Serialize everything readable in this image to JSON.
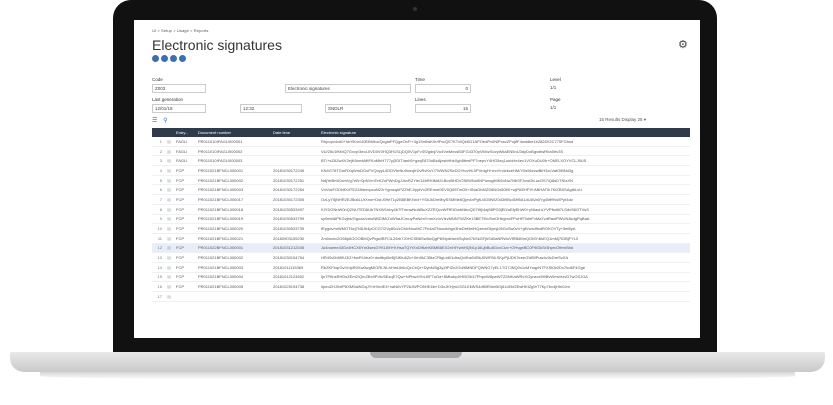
{
  "breadcrumb": "UI > Setup > Usage > Reports",
  "page": {
    "title": "Electronic signatures"
  },
  "form": {
    "code_label": "Code",
    "code_value": "Z003",
    "description_value": "Electronic signatures",
    "time_label": "Time",
    "time_value": "0",
    "level_label": "Level",
    "level_value": "1/1",
    "lastgen_label": "Last generation",
    "lastgen_date": "12/01/18",
    "lastgen_time": "12:32",
    "lastgen_user": "SNDLR",
    "lines_label": "Lines",
    "lines_value": "15",
    "page_label": "Page",
    "page_value": "1/1"
  },
  "results": {
    "text": "15 Results  Display  25  ▾"
  },
  "table": {
    "columns": [
      "",
      "",
      "Entry...",
      "Document number",
      "Date time",
      "Electronic signature"
    ],
    "rows": [
      {
        "n": "1",
        "entry": "FAGLI",
        "doc": "PR011010IFAGLI000001",
        "dt": "",
        "sig": "Rhpopv4cd0+hkYiKcnU0EBh9ocQcgiaPFQgeOcF/+3g1Sn6wK0r/tFvcQE7KTdIQkKD1APOedPv0NlPcsvZPoj8F4wddke1b2828X2C770FGhsd"
      },
      {
        "n": "2",
        "entry": "FAGLI",
        "doc": "PR011010IFAGLI000002",
        "dt": "",
        "sig": "VU/25c1fKfdQ7Gxvy/3eoL0VD0V0HQ3H1SLjDQ0V1pFv3S/gdnj/Vu4VwMxvsB3FG4370pVMxzSovyWkaEN5nU3dyDoBgxdtwRha5rtv3S"
      },
      {
        "n": "3",
        "entry": "FAGLI",
        "doc": "PR011010IFAGLI000003",
        "dt": "",
        "sig": "BT/+sZ6Zw4V2ejK6mvkMtFKoMbH777yj3OIT/anb5+gzqE870uBzAjxsbHhkXgh5tbwPF7nepvY4HG5zq1uuhHe4ev1VOXuDU0h+ONELXOYVCLJ9U5"
      },
      {
        "n": "4",
        "entry": "FCP",
        "doc": "PR011021BFNCL000001",
        "dt": "20181030172245",
        "sig": "KN4G78TGmRXqWmDGoFVQnyyL0DDVfrrNu9nnxjfrDvRvKsY/7WWN2SeDGYtovHL0PVrdgH+mnYn4vkzeHM/Y0s96zcwBIH3xLVatOiBNd3g"
      },
      {
        "n": "5",
        "entry": "FCP",
        "doc": "PR011021BFNCL000002",
        "dt": "20181030172251",
        "sig": "NdjYeBrtX0xmVg7eB+0pNVmTeKZuPWnDgJJsxRZYle/14bRHIMd2LBcxBHDV250WNu9NPunsgiMK6nNu7NbSFJcwGtLucOS7iQ8sDTNIzXN"
      },
      {
        "n": "6",
        "entry": "FCP",
        "doc": "PR011021BFNCL000003",
        "dt": "20181030172254",
        "sig": "VnVckFGDNfXdTE228rbecpcuN22rYgmzqhPZZhEJ/pytVv2REmm0EV0Q65TmD5+0NaGbMZS6NGx60lfX+wjPAEHF9+ABHATIh7KfZBSSAgi6LvU"
      },
      {
        "n": "7",
        "entry": "FCP",
        "doc": "PR011021BFNCL000017",
        "dt": "20181030172305",
        "sig": "OzLyY5jNHR2EJBu6LUrXnw+DdrJ09eTLy2B8EBKNn4+YSkJkDm9bySSMMe6Qjm4nPgfU4G0lWZ0d3i9Bc4Mf5A1dUAVa0Yg4MffHaXPpt4dz"
      },
      {
        "n": "8",
        "entry": "FCP",
        "doc": "PR011021BFNCL000018",
        "dt": "20181030533497",
        "sig": "KIYDGNnW0nQ2NUTED6Ub7NXW1hby4bTfTmnwNuNBuXZZRQvvWFfEtGwbNbuQD7t9j/4aj98PG0jE0/uEfyEhW0+yNIauhLYVPfsditi7LSdvS6OTVsS"
      },
      {
        "n": "9",
        "entry": "FCP",
        "doc": "PR011021BFNCL000019",
        "dt": "20181030533799",
        "sig": "sy0ebh6PKGvjbs/Ggoax/vmoNBDIM/ZnWhaJCmuyPaN/mYnmXv/nVlzvMNNTWZKe13BETEn/5mOHbgmxFPuHRTofeFvMa7vdRaoiPWUN4kdgPqBaA"
      },
      {
        "n": "10",
        "entry": "FCP",
        "doc": "PR011021BFNCL000020",
        "dt": "20181030533739",
        "sig": "fEpgdv/mWMOT6zj7N5Jh4pOCG7/2Vy80o/zCMvNooMC7Fb4al7Nooxbhgn3heDef4eiHQzemGfymjtJ6GcSw0vV+gfVwxdfixdROKOYTy+5ef8yA"
      },
      {
        "n": "11",
        "entry": "FCP",
        "doc": "PR011021BFNCL000021",
        "dt": "20180903155230",
        "sig": "Zm0wniv2G58p6GOOBMQvPtgs0BFCiLZ6rh7J0HCSB6Sw5wQgP6/NydrlsebSqNx07kSkGFjkSd0aNRWuViRBdMnQOMY4lkEQ1mMj7IDBjFYL0"
      },
      {
        "n": "12",
        "entry": "FCP",
        "doc": "PR011022BFNCL000001",
        "dt": "20181031212045",
        "sig": "Ju4noeee43Gx4HCX6Ym3sesGYKLBH+KHsaTQYtXnD9tzhKBMB6EX2r/HIYwhHQN1y16LjbBu8GvxCIzv+OHvgeBC0F9lGkSr3hprvOfemSbd"
      },
      {
        "n": "13",
        "entry": "FCP",
        "doc": "PR011021BFNCL000002",
        "dt": "20181030154754",
        "sig": "HR40v0h5f0U3G+bwRlJrhz0+dwifbyl0eBjSlKfu6Zo+0rh9kC35tzCRtgLb8/1dbsQx0hz6VBkJ0WF6iLSKpPjUDK7eee/ZdlSfPuw4v3cDmSvXA"
      },
      {
        "n": "14",
        "entry": "FCP",
        "doc": "PR011021BFNCL000003",
        "dt": "20181011115369",
        "sig": "RbZKFbqrGvIVdpR0Xw0wgMIGRLNLhHmUh6oQzCbQr+DybN/0g3yZtPIZv2Gd/6MNDFQWNG7yEL1TG7JNQ0x1cMYoqpN7FXSt0b2Dx7bd6F4Gge"
      },
      {
        "n": "15",
        "entry": "FCP",
        "doc": "PR011021BFNCL000004",
        "dt": "20181012124502",
        "sig": "Ijn7P6hsRHDsZEm2/QmZBx9PVb/5EzqE7Qw+NPbw4YbLf0F7uOa+8MIwbpXHBG5/47PhpcW8ywW7Z2MKaWRvXGynzxx5l9BvWmvHzvD7wOSJGA"
      },
      {
        "n": "16",
        "entry": "FCP",
        "doc": "PR011021BFNCL000005",
        "dt": "20181025194738",
        "sig": "iIpeoZHJ0xfP6XM9aiNGqJYhHVrdE4+xaN0vYP26JWPO5HE4lb+D3xJKHjm1SGLEkWS4dfl0R4mBGj61cEbf2EwHKlZg9rT7Kp7bx4jHIn0Jm"
      },
      {
        "n": "17",
        "entry": "",
        "doc": "",
        "dt": "",
        "sig": ""
      }
    ]
  },
  "colors": {
    "header_bg": "#2f3b4a",
    "accent": "#3a6fb0"
  }
}
